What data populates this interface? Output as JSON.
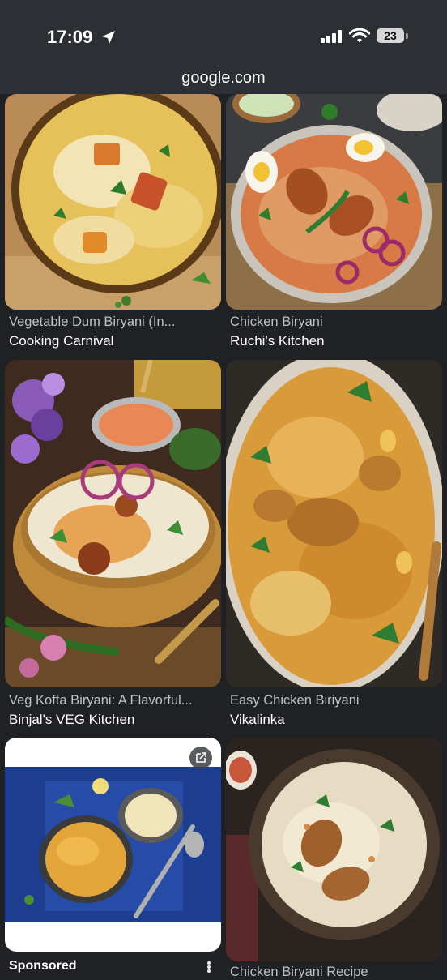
{
  "status": {
    "time": "17:09",
    "battery": "23"
  },
  "browser": {
    "url": "google.com"
  },
  "results": [
    {
      "title": "Vegetable Dum Biryani (In...",
      "source": "Cooking Carnival"
    },
    {
      "title": "Chicken Biryani",
      "source": "Ruchi's Kitchen"
    },
    {
      "title": "Veg Kofta Biryani: A Flavorful...",
      "source": "Binjal's VEG Kitchen"
    },
    {
      "title": "Easy Chicken Biriyani",
      "source": "Vikalinka"
    },
    {
      "label": "Sponsored"
    },
    {
      "title": "Chicken Biryani Recipe"
    }
  ],
  "icons": [
    "location-arrow-icon",
    "signal-icon",
    "wifi-icon",
    "battery-icon",
    "external-link-icon",
    "more-vert-icon"
  ]
}
